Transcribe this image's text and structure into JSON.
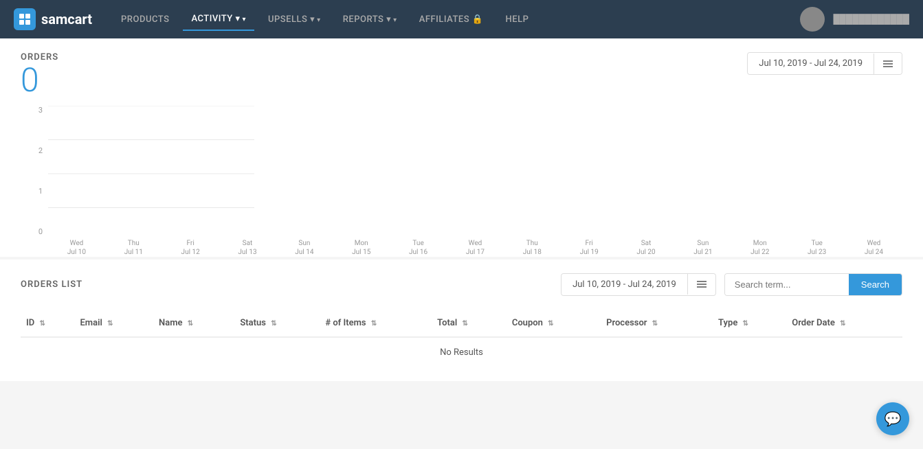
{
  "brand": {
    "name": "samcart"
  },
  "navbar": {
    "items": [
      {
        "label": "PRODUCTS",
        "id": "products",
        "active": false,
        "hasArrow": false
      },
      {
        "label": "ACTIVITY",
        "id": "activity",
        "active": true,
        "hasArrow": true
      },
      {
        "label": "UPSELLS",
        "id": "upsells",
        "active": false,
        "hasArrow": true
      },
      {
        "label": "REPORTS",
        "id": "reports",
        "active": false,
        "hasArrow": true
      },
      {
        "label": "AFFILIATES",
        "id": "affiliates",
        "active": false,
        "hasArrow": false,
        "hasLock": true
      },
      {
        "label": "HELP",
        "id": "help",
        "active": false,
        "hasArrow": false
      }
    ]
  },
  "orders": {
    "title": "ORDERS",
    "count": "0",
    "date_range": "Jul 10, 2019  -  Jul 24, 2019"
  },
  "chart": {
    "y_labels": [
      "3",
      "2",
      "1",
      "0"
    ],
    "x_labels": [
      {
        "day": "Wed",
        "date": "Jul 10"
      },
      {
        "day": "Thu",
        "date": "Jul 11"
      },
      {
        "day": "Fri",
        "date": "Jul 12"
      },
      {
        "day": "Sat",
        "date": "Jul 13"
      },
      {
        "day": "Sun",
        "date": "Jul 14"
      },
      {
        "day": "Mon",
        "date": "Jul 15"
      },
      {
        "day": "Tue",
        "date": "Jul 16"
      },
      {
        "day": "Wed",
        "date": "Jul 17"
      },
      {
        "day": "Thu",
        "date": "Jul 18"
      },
      {
        "day": "Fri",
        "date": "Jul 19"
      },
      {
        "day": "Sat",
        "date": "Jul 20"
      },
      {
        "day": "Sun",
        "date": "Jul 21"
      },
      {
        "day": "Mon",
        "date": "Jul 22"
      },
      {
        "day": "Tue",
        "date": "Jul 23"
      },
      {
        "day": "Wed",
        "date": "Jul 24"
      }
    ]
  },
  "orders_list": {
    "title": "ORDERS LIST",
    "date_range": "Jul 10, 2019  -  Jul 24, 2019",
    "search_placeholder": "Search term...",
    "search_label": "Search",
    "columns": [
      {
        "label": "ID",
        "id": "id"
      },
      {
        "label": "Email",
        "id": "email"
      },
      {
        "label": "Name",
        "id": "name"
      },
      {
        "label": "Status",
        "id": "status"
      },
      {
        "label": "# of Items",
        "id": "items"
      },
      {
        "label": "Total",
        "id": "total"
      },
      {
        "label": "Coupon",
        "id": "coupon"
      },
      {
        "label": "Processor",
        "id": "processor"
      },
      {
        "label": "Type",
        "id": "type"
      },
      {
        "label": "Order Date",
        "id": "order_date"
      }
    ],
    "no_results": "No Results"
  }
}
